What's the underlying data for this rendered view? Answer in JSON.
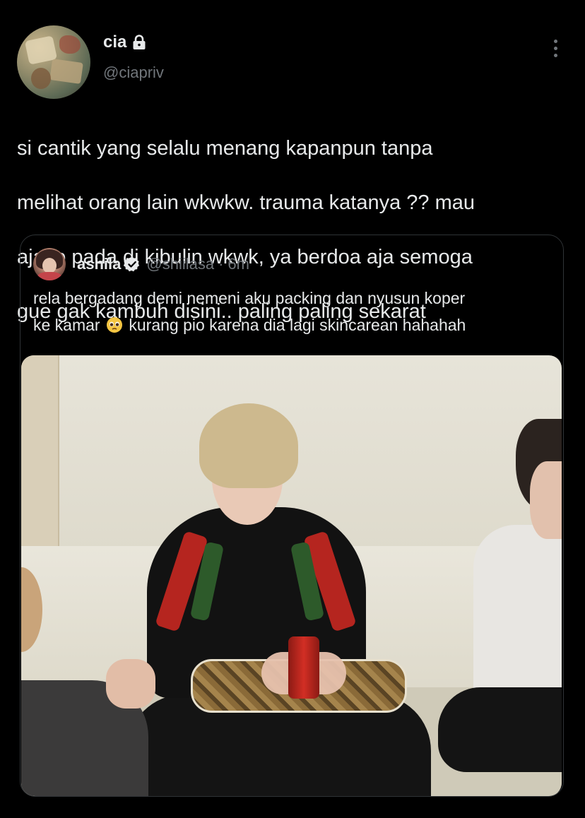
{
  "author": {
    "display_name": "cia",
    "handle": "@ciapriv",
    "protected": true
  },
  "tweet": {
    "text_lines": [
      "si cantik yang selalu menang kapanpun tanpa",
      "melihat orang lain wkwkw. trauma katanya ?? mau",
      "aja lo pada di kibulin wkwk, ya berdoa aja semoga",
      "gue gak kambuh disini.. paling paling sekarat"
    ]
  },
  "quote": {
    "display_name": "ashila",
    "verified": true,
    "handle": "@shiilasa",
    "separator": "·",
    "time": "6m",
    "text_part1": "rela bergadang demi nemeni aku packing dan nyusun koper",
    "text_part2": "ke kamar",
    "text_part3": "kurang pio karena dia lagi skincarean hahahah",
    "emoji": "pleading-face-icon",
    "media": "photo"
  },
  "icons": {
    "lock": "lock-icon",
    "verified": "verified-badge-icon",
    "more": "more-options-icon"
  },
  "colors": {
    "background": "#000000",
    "text_primary": "#e7e9ea",
    "text_secondary": "#71767b",
    "border": "#2f3336"
  }
}
